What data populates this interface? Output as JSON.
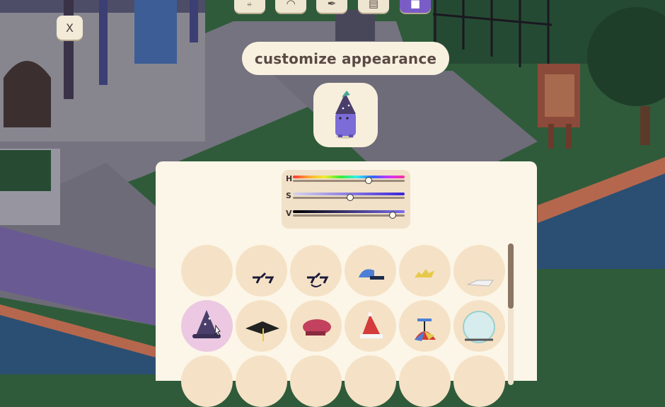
{
  "window": {
    "close_label": "X"
  },
  "toolbar": {
    "buttons": [
      {
        "icon": "chair-icon",
        "glyph": "⍅"
      },
      {
        "icon": "hat-icon",
        "glyph": "◠"
      },
      {
        "icon": "brush-icon",
        "glyph": "✒"
      },
      {
        "icon": "book-icon",
        "glyph": "▤"
      },
      {
        "icon": "shirt-icon",
        "glyph": "■"
      }
    ]
  },
  "header": {
    "title": "customize appearance"
  },
  "color_picker": {
    "h_label": "H",
    "s_label": "S",
    "v_label": "V",
    "h_value": 0.68,
    "s_value": 0.51,
    "v_value": 0.89
  },
  "colors": {
    "panel_bg": "#fcf6e8",
    "slot_bg": "#f5e2c6",
    "slot_selected": "#ecc8e2",
    "accent": "#7a5cc7"
  },
  "hats": [
    "none",
    "glasses-icon",
    "glasses-2-icon",
    "blue-cap-icon",
    "gold-crown-icon",
    "white-visor-icon",
    "wizard-hat-icon",
    "grad-cap-icon",
    "red-beret-icon",
    "santa-hat-icon",
    "propeller-hat-icon",
    "glass-dome-icon"
  ],
  "selected_hat": "wizard-hat-icon"
}
